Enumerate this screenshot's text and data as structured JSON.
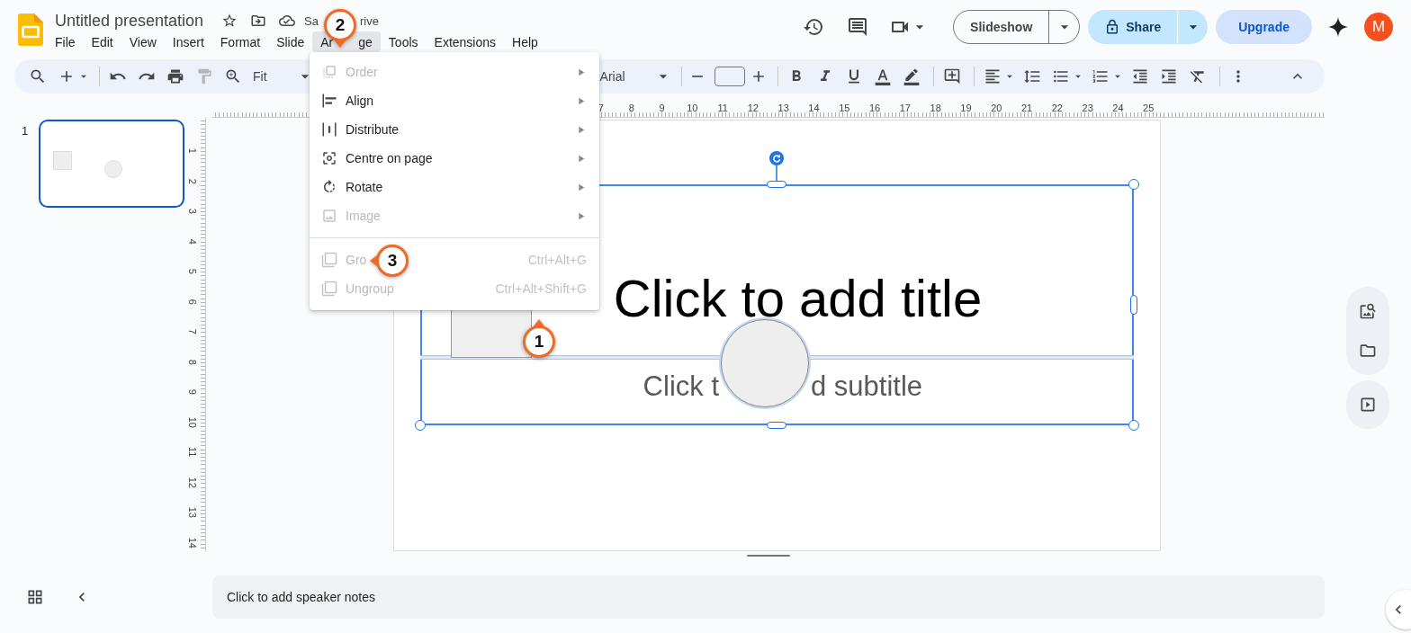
{
  "app": {
    "title": "Untitled presentation",
    "save_status_start": "Sa",
    "save_status_end": "rive"
  },
  "menu_bar": [
    {
      "label": "File",
      "selected": false
    },
    {
      "label": "Edit",
      "selected": false
    },
    {
      "label": "View",
      "selected": false
    },
    {
      "label": "Insert",
      "selected": false
    },
    {
      "label": "Format",
      "selected": false
    },
    {
      "label": "Slide",
      "selected": false
    },
    {
      "label": "Ar",
      "label_end": "ge",
      "selected": true
    },
    {
      "label": "Tools",
      "selected": false
    },
    {
      "label": "Extensions",
      "selected": false
    },
    {
      "label": "Help",
      "selected": false
    }
  ],
  "header_buttons": {
    "slideshow": "Slideshow",
    "share": "Share",
    "upgrade": "Upgrade",
    "avatar": "M"
  },
  "toolbar": {
    "zoom": "Fit",
    "font": "Arial"
  },
  "arrange_menu": [
    {
      "kind": "submenu",
      "label": "Order",
      "disabled": true
    },
    {
      "kind": "submenu",
      "label": "Align",
      "disabled": false
    },
    {
      "kind": "submenu",
      "label": "Distribute",
      "disabled": false
    },
    {
      "kind": "submenu",
      "label": "Centre on page",
      "disabled": false
    },
    {
      "kind": "submenu",
      "label": "Rotate",
      "disabled": false
    },
    {
      "kind": "submenu",
      "label": "Image",
      "disabled": true
    },
    {
      "kind": "divider"
    },
    {
      "kind": "command",
      "label": "Gro",
      "shortcut": "Ctrl+Alt+G",
      "disabled": true
    },
    {
      "kind": "command",
      "label": "Ungroup",
      "shortcut": "Ctrl+Alt+Shift+G",
      "disabled": true
    }
  ],
  "ruler": {
    "horizontal": [
      "7",
      "8",
      "9",
      "10",
      "11",
      "12",
      "13",
      "14",
      "15",
      "16",
      "17",
      "18",
      "19",
      "20",
      "21",
      "22",
      "23",
      "24",
      "25"
    ],
    "vertical": [
      "1",
      "2",
      "3",
      "4",
      "5",
      "6",
      "7",
      "8",
      "9",
      "10",
      "11",
      "12",
      "13",
      "14"
    ]
  },
  "filmstrip": [
    {
      "number": "1",
      "selected": true
    }
  ],
  "slide": {
    "title": "Click to add title",
    "subtitle_start": "Click t",
    "subtitle_end": "d subtitle"
  },
  "notes": {
    "text": "Click to add speaker notes"
  },
  "callouts": [
    {
      "number": "1"
    },
    {
      "number": "2"
    },
    {
      "number": "3"
    }
  ]
}
